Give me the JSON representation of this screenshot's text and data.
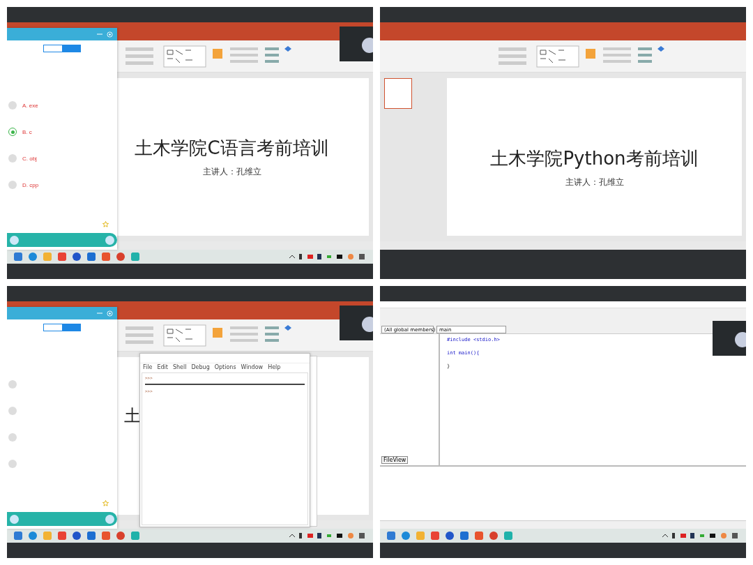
{
  "screens": [
    {
      "kind": "slides_with_quiz",
      "slide": {
        "title": "土木学院C语言考前培训",
        "presenter": "主讲人：孔维立"
      },
      "quiz": {
        "options": [
          {
            "label": "A. exe",
            "selected": false
          },
          {
            "label": "B. c",
            "selected": true
          },
          {
            "label": "C. obj",
            "selected": false
          },
          {
            "label": "D. cpp",
            "selected": false
          }
        ]
      }
    },
    {
      "kind": "slides",
      "slide": {
        "title": "土木学院Python考前培训",
        "presenter": "主讲人：孔维立"
      }
    },
    {
      "kind": "slides_with_quiz_shell",
      "slide": {
        "title": "土"
      },
      "quiz": {
        "options": [
          {
            "selected": false
          },
          {
            "selected": false
          },
          {
            "selected": false
          },
          {
            "selected": false
          }
        ]
      },
      "shell": {
        "menu": [
          "File",
          "Edit",
          "Shell",
          "Debug",
          "Options",
          "Window",
          "Help"
        ],
        "prompts": [
          ">>>",
          ">>>"
        ]
      }
    },
    {
      "kind": "code_editor",
      "selectors": [
        "(All global members)",
        "main"
      ],
      "code": [
        "#include <stdio.h>",
        "int main(){",
        "}"
      ],
      "tab": "FileView"
    }
  ]
}
